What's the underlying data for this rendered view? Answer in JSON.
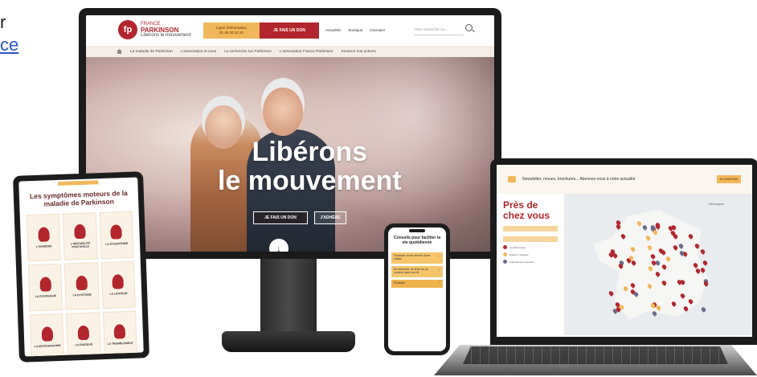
{
  "left_fragment": {
    "line1": "r",
    "line2": "ce"
  },
  "monitor": {
    "logo": {
      "mark": "fp",
      "top": "FRANCE",
      "name": "PARKINSON",
      "tagline": "Libérons le mouvement"
    },
    "info_line": {
      "title": "Ligne d'information",
      "phone": "01 45 20 22 20"
    },
    "donate_label": "JE FAIS UN DON",
    "top_links": [
      "Actualités",
      "Boutique",
      "Glossaire"
    ],
    "search_placeholder": "Votre recherche ou...",
    "nav_items": [
      "La maladie de Parkinson",
      "L'association et vous",
      "La recherche sur Parkinson",
      "L'association France Parkinson",
      "Soutenir nos actions"
    ],
    "hero": {
      "title_line1": "Libérons",
      "title_line2": "le mouvement",
      "donate_btn": "JE FAIS UN DON",
      "join_btn": "J'ADHÈRE",
      "arrow": "↓"
    }
  },
  "tablet": {
    "title": "Les symptômes moteurs de la maladie de Parkinson",
    "cards": [
      "L'AKINÉSIE",
      "L'INSTABILITÉ POSTURALE",
      "LA DYSARTHRIE",
      "LA DYSPHAGIE",
      "LA DYSTONIE",
      "LA LENTEUR",
      "LA MICROGRAPHIE",
      "LA RAIDEUR",
      "LA TREMBLEMENT"
    ]
  },
  "phone": {
    "title": "Conseils pour faciliter la vie quotidienne",
    "accordions": [
      "S'assurer ou se relever d'une chaise",
      "Se retourner, se lever ou se coucher dans son lit",
      "S'habiller"
    ]
  },
  "laptop": {
    "newsletter": "Newsletter, revues, brochures... Abonnez-vous à notre actualité",
    "newsletter_btn": "JE M'ABONNE",
    "near_title_line1": "Près de",
    "near_title_line2": "chez vous",
    "legend": [
      "Comités locaux",
      "Ateliers / Activités",
      "Antennes de ressource"
    ],
    "map_label": "Allemagne"
  },
  "colors": {
    "brand_red": "#b3262d",
    "accent_yellow": "#f2b75a"
  }
}
